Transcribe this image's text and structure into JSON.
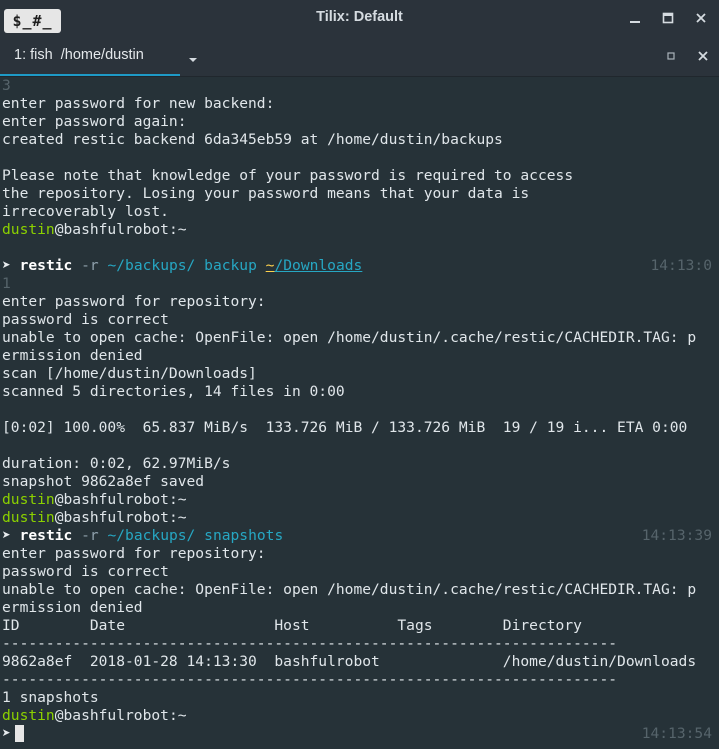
{
  "window": {
    "app_icon_text": "$_#_",
    "title": "Tilix: Default"
  },
  "tab": {
    "label": "1: fish  /home/dustin"
  },
  "terminal": {
    "l0": "3",
    "l1": "enter password for new backend:",
    "l2": "enter password again:",
    "l3": "created restic backend 6da345eb59 at /home/dustin/backups",
    "l5": "Please note that knowledge of your password is required to access",
    "l6": "the repository. Losing your password means that your data is",
    "l7": "irrecoverably lost.",
    "user": "dustin",
    "host": "@bashfulrobot:~",
    "cmd1": {
      "arrow": "➤",
      "bin": "restic",
      "flag": "-r",
      "repo": "~/backups/",
      "sub": "backup",
      "tilde": "~",
      "target": "/Downloads",
      "time": "14:13:0"
    },
    "l11": "1",
    "l12": "enter password for repository:",
    "l13": "password is correct",
    "l14": "unable to open cache: OpenFile: open /home/dustin/.cache/restic/CACHEDIR.TAG: p",
    "l15": "ermission denied",
    "l16": "scan [/home/dustin/Downloads]",
    "l17": "scanned 5 directories, 14 files in 0:00",
    "l19": "[0:02] 100.00%  65.837 MiB/s  133.726 MiB / 133.726 MiB  19 / 19 i... ETA 0:00",
    "l21": "duration: 0:02, 62.97MiB/s",
    "l22": "snapshot 9862a8ef saved",
    "cmd2": {
      "arrow": "➤",
      "bin": "restic",
      "flag": "-r",
      "repo": "~/backups/",
      "sub": "snapshots",
      "time": "14:13:39"
    },
    "l26": "enter password for repository:",
    "l27": "password is correct",
    "l28": "unable to open cache: OpenFile: open /home/dustin/.cache/restic/CACHEDIR.TAG: p",
    "l29": "ermission denied",
    "l30": "ID        Date                 Host          Tags        Directory",
    "l31": "----------------------------------------------------------------------",
    "l32": "9862a8ef  2018-01-28 14:13:30  bashfulrobot              /home/dustin/Downloads",
    "l33": "----------------------------------------------------------------------",
    "l34": "1 snapshots",
    "prompt_arrow": "➤",
    "last_time": "14:13:54"
  },
  "colors": {
    "background": "#263238",
    "chrome": "#2b333b",
    "accent": "#1e9ac6",
    "user": "#8bd100",
    "command_arg": "#26a7c3"
  },
  "icons": [
    "minimize-icon",
    "maximize-icon",
    "close-icon",
    "chevron-down-icon",
    "restore-pane-icon",
    "close-tab-icon"
  ]
}
